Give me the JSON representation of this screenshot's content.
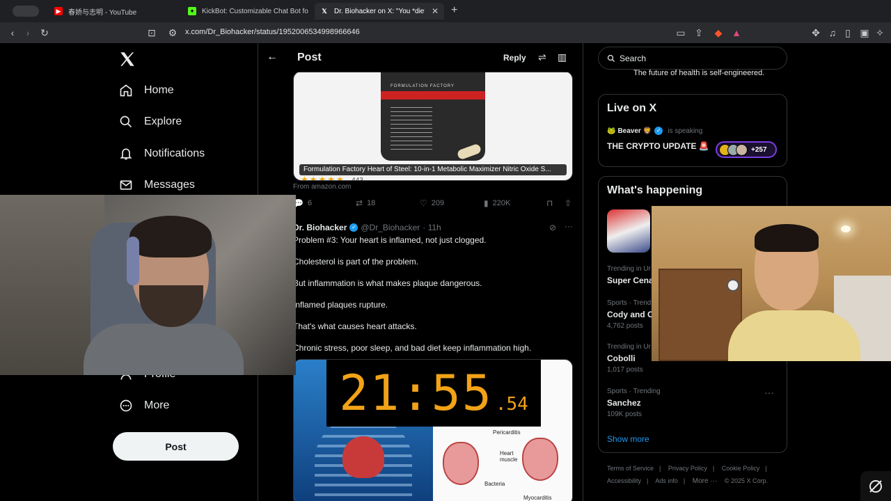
{
  "browser": {
    "tabs": [
      {
        "title": "春娇与志明 - YouTube",
        "favicon_color": "#ff0000"
      },
      {
        "title": "KickBot: Customizable Chat Bot fo",
        "favicon_color": "#53fc18"
      },
      {
        "title": "Dr. Biohacker on X: \"You *die*",
        "favicon_color": "#ffffff"
      }
    ],
    "url": "x.com/Dr_Biohacker/status/1952006534998966646"
  },
  "nav": {
    "items": [
      {
        "label": "Home",
        "icon": "home-icon"
      },
      {
        "label": "Explore",
        "icon": "search-icon"
      },
      {
        "label": "Notifications",
        "icon": "bell-icon"
      },
      {
        "label": "Messages",
        "icon": "mail-icon"
      },
      {
        "label": "Profile",
        "icon": "person-icon"
      },
      {
        "label": "More",
        "icon": "more-circle-icon"
      }
    ],
    "post_button": "Post"
  },
  "header": {
    "title": "Post",
    "reply": "Reply"
  },
  "product_card": {
    "brand": "FORMULATION FACTORY",
    "caption": "Formulation Factory Heart of Steel: 10-in-1 Metabolic Maximizer Nitric Oxide S...",
    "from": "From amazon.com",
    "stars": "★★★★★",
    "rating_count": "443"
  },
  "tweet_actions": {
    "replies": "6",
    "reposts": "18",
    "likes": "209",
    "views": "220K"
  },
  "reply_tweet": {
    "name": "Dr. Biohacker",
    "handle": "@Dr_Biohacker",
    "time": "· 11h",
    "lines": [
      "Problem #3: Your heart is inflamed, not just clogged.",
      "Cholesterol is part of the problem.",
      "But inflammation is what makes plaque dangerous.",
      "Inflamed plaques rupture.",
      "That's what causes heart attacks.",
      "Chronic stress, poor sleep, and bad diet keep inflammation high."
    ],
    "diagram_labels": {
      "pericarditis": "Pericarditis",
      "heart_muscle": "Heart muscle",
      "bacteria": "Bacteria",
      "myocarditis": "Myocarditis"
    }
  },
  "timer": {
    "main": "21:55",
    "fraction": ".54"
  },
  "right": {
    "search_placeholder": "Search",
    "bio_peek": "The future of health is self-engineered.",
    "live": {
      "title": "Live on X",
      "host": "Beaver",
      "status": "is speaking",
      "space_title": "THE CRYPTO UPDATE 🚨",
      "listeners": "+257"
    },
    "happening": {
      "title": "What's happening",
      "trends": [
        {
          "context": "Trending in Ur",
          "name": "Super Cena",
          "count": ""
        },
        {
          "context": "Sports · Trend",
          "name": "Cody and C",
          "count": "4,762 posts"
        },
        {
          "context": "Trending in Ur",
          "name": "Cobolli",
          "count": "1,017 posts"
        },
        {
          "context": "Sports · Trending",
          "name": "Sanchez",
          "count": "109K posts"
        }
      ],
      "show_more": "Show more"
    },
    "footer": {
      "row1": [
        "Terms of Service",
        "Privacy Policy",
        "Cookie Policy"
      ],
      "row2": [
        "Accessibility",
        "Ads info",
        "More ···",
        "© 2025 X Corp."
      ]
    }
  }
}
